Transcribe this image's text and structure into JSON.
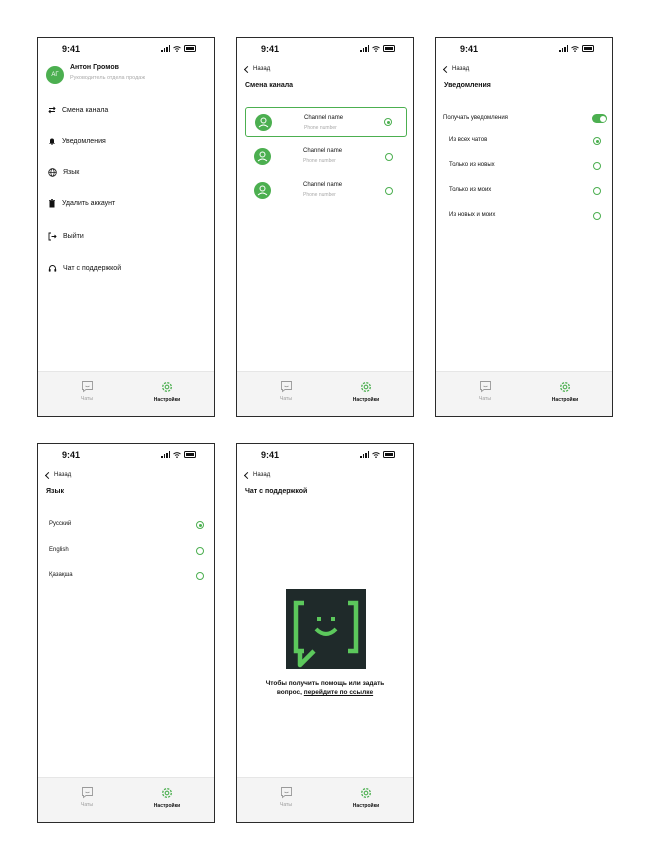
{
  "colors": {
    "accent": "#4caf50",
    "border": "#2b2b2b"
  },
  "status": {
    "time": "9:41"
  },
  "back_label": "Назад",
  "tabs": {
    "chats": "Чаты",
    "settings": "Настройки"
  },
  "settings": {
    "avatar_initials": "АГ",
    "user_name": "Антон Громов",
    "user_role": "Руководитель отдела продаж",
    "items": [
      {
        "label": "Смена канала",
        "icon": "switch-icon"
      },
      {
        "label": "Уведомления",
        "icon": "bell-icon"
      },
      {
        "label": "Язык",
        "icon": "globe-icon"
      },
      {
        "label": "Удалить аккаунт",
        "icon": "trash-icon"
      },
      {
        "label": "Выйти",
        "icon": "logout-icon"
      },
      {
        "label": "Чат с поддержкой",
        "icon": "headset-icon"
      }
    ]
  },
  "channels": {
    "title": "Смена канала",
    "items": [
      {
        "name": "Channel name",
        "phone": "Phone number",
        "selected": true
      },
      {
        "name": "Channel name",
        "phone": "Phone number",
        "selected": false
      },
      {
        "name": "Channel name",
        "phone": "Phone number",
        "selected": false
      }
    ]
  },
  "notifications": {
    "title": "Уведомления",
    "toggle_label": "Получать уведомления",
    "toggle_on": true,
    "options": [
      {
        "label": "Из всех чатов",
        "selected": true
      },
      {
        "label": "Только из новых",
        "selected": false
      },
      {
        "label": "Только из моих",
        "selected": false
      },
      {
        "label": "Из новых и моих",
        "selected": false
      }
    ]
  },
  "language": {
    "title": "Язык",
    "options": [
      {
        "label": "Русский",
        "selected": true
      },
      {
        "label": "English",
        "selected": false
      },
      {
        "label": "Қазақша",
        "selected": false
      }
    ]
  },
  "support": {
    "title": "Чат с поддержкой",
    "text_line1": "Чтобы получить помощь или задать",
    "text_prefix": "вопрос, ",
    "link_text": "перейдите по ссылке"
  }
}
